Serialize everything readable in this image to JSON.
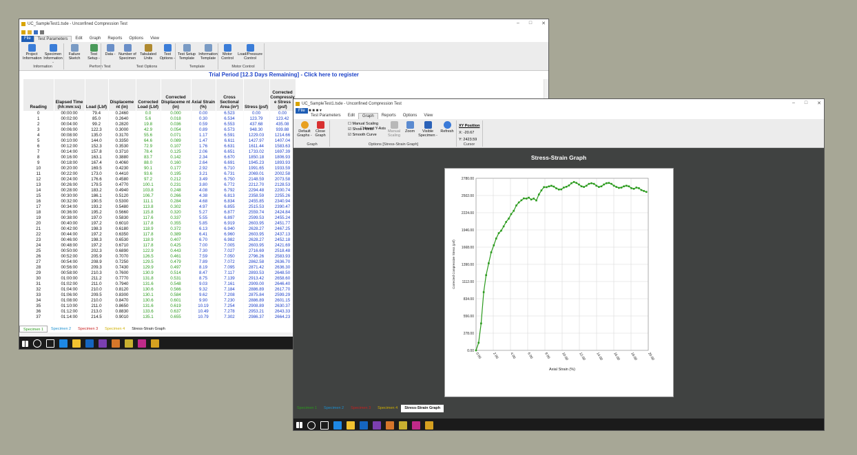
{
  "win1": {
    "title": "UC_SampleTest1.tsde - Unconfined Compression Test",
    "menu": [
      "Test Parameters",
      "Edit",
      "Graph",
      "Reports",
      "Options",
      "View"
    ],
    "file_label": "File",
    "ribbon_buttons": [
      {
        "label": "Project Information",
        "icon": "project-info-icon",
        "color": "#3b7dd8"
      },
      {
        "label": "Specimen Information -",
        "icon": "specimen-info-icon",
        "color": "#3b7dd8"
      },
      {
        "label": "Failure Sketch",
        "icon": "failure-sketch-icon",
        "color": "#7a9bc4"
      },
      {
        "label": "Test Setup -",
        "icon": "test-setup-icon",
        "color": "#4a9a5a"
      },
      {
        "label": "Data -",
        "icon": "data-icon",
        "color": "#6a8fc8"
      },
      {
        "label": "Number of Specimen",
        "icon": "number-of-specimen-icon",
        "color": "#6a8fc8"
      },
      {
        "label": "Tabulated Units",
        "icon": "tabulated-units-icon",
        "color": "#b08a30"
      },
      {
        "label": "Test Options -",
        "icon": "test-options-icon",
        "color": "#3b7dd8"
      },
      {
        "label": "Test Setup Template",
        "icon": "test-setup-template-icon",
        "color": "#7a9bc4"
      },
      {
        "label": "Information Template",
        "icon": "information-template-icon",
        "color": "#7a9bc4"
      },
      {
        "label": "Motor Control",
        "icon": "motor-control-icon",
        "color": "#3b7dd8"
      },
      {
        "label": "Load/Pressure Control",
        "icon": "load-pressure-control-icon",
        "color": "#3b7dd8"
      }
    ],
    "groups": [
      "Information",
      "Perform Test",
      "Test Options",
      "Template",
      "Motor Control"
    ],
    "trial_banner": "Trial Period [12.3 Days Remaining] - Click here to register",
    "columns": [
      "Reading",
      "Elapsed Time (hh:mm:ss)",
      "Load (Lbf)",
      "Displaceme nt (in)",
      "Corrected Load (Lbf)",
      "Corrected Displaceme nt (in)",
      "Axial Strain (%)",
      "Cross Sectional Area (in²)",
      "Stress (psf)",
      "Corrected Compressiv e Stress (psf)"
    ],
    "rows": [
      [
        "0",
        "00:00:00",
        "79.4",
        "0.2460",
        "0.0",
        "0.000",
        "0.00",
        "6.523",
        "0.00",
        "0.00"
      ],
      [
        "1",
        "00:02:00",
        "85.0",
        "0.2640",
        "5.6",
        "0.018",
        "0.30",
        "6.534",
        "123.79",
        "123.42"
      ],
      [
        "2",
        "00:04:00",
        "99.2",
        "0.2820",
        "19.8",
        "0.036",
        "0.59",
        "6.553",
        "437.68",
        "435.08"
      ],
      [
        "3",
        "00:06:00",
        "122.3",
        "0.3000",
        "42.9",
        "0.054",
        "0.89",
        "6.573",
        "948.30",
        "939.88"
      ],
      [
        "4",
        "00:08:00",
        "135.0",
        "0.3170",
        "55.6",
        "0.071",
        "1.17",
        "6.591",
        "1229.03",
        "1214.66"
      ],
      [
        "5",
        "00:10:00",
        "144.0",
        "0.3350",
        "64.6",
        "0.089",
        "1.47",
        "6.611",
        "1427.97",
        "1407.04"
      ],
      [
        "6",
        "00:12:00",
        "152.3",
        "0.3530",
        "72.9",
        "0.107",
        "1.76",
        "6.631",
        "1611.44",
        "1583.63"
      ],
      [
        "7",
        "00:14:00",
        "157.8",
        "0.3710",
        "78.4",
        "0.125",
        "2.06",
        "6.651",
        "1733.02",
        "1697.39"
      ],
      [
        "8",
        "00:16:00",
        "163.1",
        "0.3880",
        "83.7",
        "0.142",
        "2.34",
        "6.670",
        "1850.18",
        "1806.93"
      ],
      [
        "9",
        "00:18:00",
        "167.4",
        "0.4060",
        "88.0",
        "0.160",
        "2.64",
        "6.691",
        "1945.23",
        "1893.93"
      ],
      [
        "10",
        "00:20:00",
        "169.5",
        "0.4230",
        "90.1",
        "0.177",
        "2.92",
        "6.710",
        "1991.65",
        "1933.59"
      ],
      [
        "11",
        "00:22:00",
        "173.0",
        "0.4410",
        "93.6",
        "0.195",
        "3.21",
        "6.731",
        "2069.01",
        "2002.58"
      ],
      [
        "12",
        "00:24:00",
        "176.6",
        "0.4580",
        "97.2",
        "0.212",
        "3.49",
        "6.750",
        "2148.59",
        "2073.58"
      ],
      [
        "13",
        "00:26:00",
        "179.5",
        "0.4770",
        "100.1",
        "0.231",
        "3.80",
        "6.772",
        "2212.70",
        "2128.53"
      ],
      [
        "14",
        "00:28:00",
        "183.2",
        "0.4940",
        "103.8",
        "0.248",
        "4.08",
        "6.792",
        "2294.48",
        "2200.74"
      ],
      [
        "15",
        "00:30:00",
        "186.1",
        "0.5120",
        "106.7",
        "0.266",
        "4.38",
        "6.813",
        "2358.59",
        "2255.26"
      ],
      [
        "16",
        "00:32:00",
        "190.5",
        "0.5300",
        "111.1",
        "0.284",
        "4.68",
        "6.834",
        "2455.85",
        "2340.94"
      ],
      [
        "17",
        "00:34:00",
        "193.2",
        "0.5480",
        "113.8",
        "0.302",
        "4.97",
        "6.855",
        "2515.53",
        "2390.47"
      ],
      [
        "18",
        "00:36:00",
        "195.2",
        "0.5660",
        "115.8",
        "0.320",
        "5.27",
        "6.877",
        "2559.74",
        "2424.84"
      ],
      [
        "19",
        "00:38:00",
        "197.0",
        "0.5830",
        "117.6",
        "0.337",
        "5.55",
        "6.897",
        "2599.53",
        "2455.24"
      ],
      [
        "20",
        "00:40:00",
        "197.2",
        "0.6010",
        "117.8",
        "0.355",
        "5.85",
        "6.919",
        "2603.95",
        "2451.77"
      ],
      [
        "21",
        "00:42:00",
        "198.3",
        "0.6180",
        "118.9",
        "0.372",
        "6.13",
        "6.940",
        "2628.27",
        "2467.25"
      ],
      [
        "22",
        "00:44:00",
        "197.2",
        "0.6350",
        "117.8",
        "0.389",
        "6.41",
        "6.960",
        "2603.95",
        "2437.13"
      ],
      [
        "23",
        "00:46:00",
        "198.3",
        "0.6530",
        "118.9",
        "0.407",
        "6.70",
        "6.982",
        "2628.27",
        "2452.18"
      ],
      [
        "24",
        "00:48:00",
        "197.2",
        "0.6710",
        "117.8",
        "0.425",
        "7.00",
        "7.005",
        "2603.95",
        "2421.69"
      ],
      [
        "25",
        "00:50:00",
        "202.3",
        "0.6890",
        "122.9",
        "0.443",
        "7.30",
        "7.027",
        "2716.69",
        "2518.48"
      ],
      [
        "26",
        "00:52:00",
        "205.9",
        "0.7070",
        "126.5",
        "0.461",
        "7.59",
        "7.050",
        "2796.26",
        "2583.93"
      ],
      [
        "27",
        "00:54:00",
        "208.9",
        "0.7250",
        "129.5",
        "0.479",
        "7.89",
        "7.072",
        "2862.58",
        "2636.70"
      ],
      [
        "28",
        "00:56:00",
        "209.3",
        "0.7430",
        "129.9",
        "0.497",
        "8.19",
        "7.095",
        "2871.42",
        "2636.30"
      ],
      [
        "29",
        "00:58:00",
        "210.3",
        "0.7600",
        "130.9",
        "0.514",
        "8.47",
        "7.117",
        "2893.53",
        "2648.50"
      ],
      [
        "30",
        "01:00:00",
        "211.2",
        "0.7770",
        "131.8",
        "0.531",
        "8.75",
        "7.139",
        "2913.42",
        "2658.60"
      ],
      [
        "31",
        "01:02:00",
        "211.0",
        "0.7940",
        "131.6",
        "0.548",
        "9.03",
        "7.161",
        "2909.00",
        "2646.40"
      ],
      [
        "32",
        "01:04:00",
        "210.0",
        "0.8120",
        "130.6",
        "0.566",
        "9.32",
        "7.184",
        "2886.89",
        "2617.70"
      ],
      [
        "33",
        "01:06:00",
        "209.5",
        "0.8300",
        "130.1",
        "0.584",
        "9.62",
        "7.208",
        "2875.84",
        "2599.29"
      ],
      [
        "34",
        "01:08:00",
        "210.0",
        "0.8470",
        "130.6",
        "0.601",
        "9.90",
        "7.230",
        "2886.89",
        "2601.15"
      ],
      [
        "35",
        "01:10:00",
        "211.0",
        "0.8650",
        "131.6",
        "0.619",
        "10.19",
        "7.254",
        "2908.89",
        "2630.37"
      ],
      [
        "36",
        "01:12:00",
        "213.0",
        "0.8830",
        "133.6",
        "0.637",
        "10.49",
        "7.278",
        "2953.21",
        "2643.33"
      ],
      [
        "37",
        "01:14:00",
        "214.5",
        "0.9010",
        "135.1",
        "0.655",
        "10.79",
        "7.302",
        "2986.37",
        "2664.23"
      ]
    ],
    "tabs": [
      {
        "label": "Specimen 1",
        "color": "#2a9a1c",
        "active": true
      },
      {
        "label": "Specimen 2",
        "color": "#1a8fd0",
        "active": false
      },
      {
        "label": "Specimen 3",
        "color": "#c81e1e",
        "active": false
      },
      {
        "label": "Specimen 4",
        "color": "#d0b000",
        "active": false
      },
      {
        "label": "Stress-Strain Graph",
        "color": "#111111",
        "active": false
      }
    ]
  },
  "win2": {
    "title": "UC_SampleTest1.tsde - Unconfined Compression Test",
    "menu": [
      "Test Parameters",
      "Edit",
      "Graph",
      "Reports",
      "Options",
      "View"
    ],
    "file_label": "File",
    "ribbon": {
      "default_graphs": "Default Graphs -",
      "close_graph": "Close Graph",
      "graph_group": "Graph",
      "manual_scaling": "Manual Scaling",
      "show_points": "Show Points",
      "smooth_curve": "Smooth Curve",
      "invert_y": "Invert Y-Axis",
      "manual_scaling_btn": "Manual Scaling",
      "zoom": "Zoom",
      "visible_specimen": "Visible Specimen -",
      "refresh": "Refresh",
      "options_group": "Options [Stress-Strain Graph]",
      "xy_title": "XY Position",
      "x_value": "X: -20.67",
      "y_value": "Y: 2423.59",
      "cursor_group": "Cursor"
    },
    "checks": {
      "manual_scaling": false,
      "show_points": true,
      "smooth_curve": true,
      "invert_y": false
    },
    "graph_title": "Stress-Strain Graph",
    "tabs": [
      {
        "label": "Specimen 1",
        "color": "#2a9a1c",
        "active": false
      },
      {
        "label": "Specimen 2",
        "color": "#1a8fd0",
        "active": false
      },
      {
        "label": "Specimen 3",
        "color": "#c81e1e",
        "active": false
      },
      {
        "label": "Specimen 4",
        "color": "#d0b000",
        "active": false
      },
      {
        "label": "Stress-Strain Graph",
        "color": "#111111",
        "active": true
      }
    ]
  },
  "taskbar_icons": [
    {
      "name": "windows-start-icon",
      "color": "#ffffff"
    },
    {
      "name": "search-icon",
      "color": "#ffffff"
    },
    {
      "name": "task-view-icon",
      "color": "#ffffff"
    },
    {
      "name": "edge-icon",
      "color": "#1e88e5"
    },
    {
      "name": "explorer-icon",
      "color": "#f2c230"
    },
    {
      "name": "outlook-icon",
      "color": "#1565c0"
    },
    {
      "name": "visual-studio-icon",
      "color": "#7b3fb0"
    },
    {
      "name": "app-icon-1",
      "color": "#d6762a"
    },
    {
      "name": "app-icon-2",
      "color": "#c8b030"
    },
    {
      "name": "app-icon-3",
      "color": "#c02a8a"
    },
    {
      "name": "app-icon-4",
      "color": "#d6a020"
    }
  ],
  "chart_data": {
    "type": "scatter",
    "title": "",
    "xlabel": "Axial Strain (%)",
    "ylabel": "Corrected Compressive Stress (psf)",
    "xlim": [
      0,
      20
    ],
    "ylim": [
      0,
      2780
    ],
    "xticks": [
      "0.00",
      "2.00",
      "4.00",
      "6.00",
      "8.00",
      "10.00",
      "12.00",
      "14.00",
      "16.00",
      "18.00",
      "20.00"
    ],
    "yticks": [
      "0.00",
      "278.00",
      "556.00",
      "834.00",
      "1112.00",
      "1390.00",
      "1668.00",
      "1946.00",
      "2224.00",
      "2502.00",
      "2780.00"
    ],
    "grid": true,
    "series": [
      {
        "color": "#2a9a1c",
        "x": [
          0.0,
          0.3,
          0.59,
          0.89,
          1.17,
          1.47,
          1.76,
          2.06,
          2.34,
          2.64,
          2.92,
          3.21,
          3.49,
          3.8,
          4.08,
          4.38,
          4.68,
          4.97,
          5.27,
          5.55,
          5.85,
          6.13,
          6.41,
          6.7,
          7.0,
          7.3,
          7.59,
          7.89,
          8.19,
          8.47,
          8.75,
          9.03,
          9.32,
          9.62,
          9.9,
          10.19,
          10.49,
          10.79,
          11.08,
          11.37,
          11.66,
          11.95,
          12.24,
          12.53,
          12.82,
          13.11,
          13.4,
          13.69,
          13.98,
          14.27,
          14.56,
          14.85,
          15.14,
          15.43,
          15.72,
          16.01,
          16.3,
          16.59,
          16.88,
          17.17,
          17.46,
          17.75,
          18.04,
          18.33,
          18.62,
          18.91,
          19.2,
          19.49,
          19.78
        ],
        "y": [
          0,
          123,
          435,
          940,
          1215,
          1407,
          1584,
          1697,
          1807,
          1894,
          1934,
          2003,
          2074,
          2129,
          2201,
          2255,
          2341,
          2390,
          2425,
          2455,
          2452,
          2467,
          2437,
          2452,
          2422,
          2518,
          2584,
          2637,
          2636,
          2649,
          2659,
          2646,
          2618,
          2599,
          2601,
          2630,
          2643,
          2664,
          2700,
          2720,
          2705,
          2680,
          2650,
          2640,
          2660,
          2690,
          2700,
          2690,
          2660,
          2640,
          2650,
          2680,
          2700,
          2705,
          2690,
          2660,
          2640,
          2625,
          2630,
          2650,
          2660,
          2650,
          2620,
          2610,
          2630,
          2620,
          2590,
          2575,
          2560
        ]
      }
    ]
  }
}
